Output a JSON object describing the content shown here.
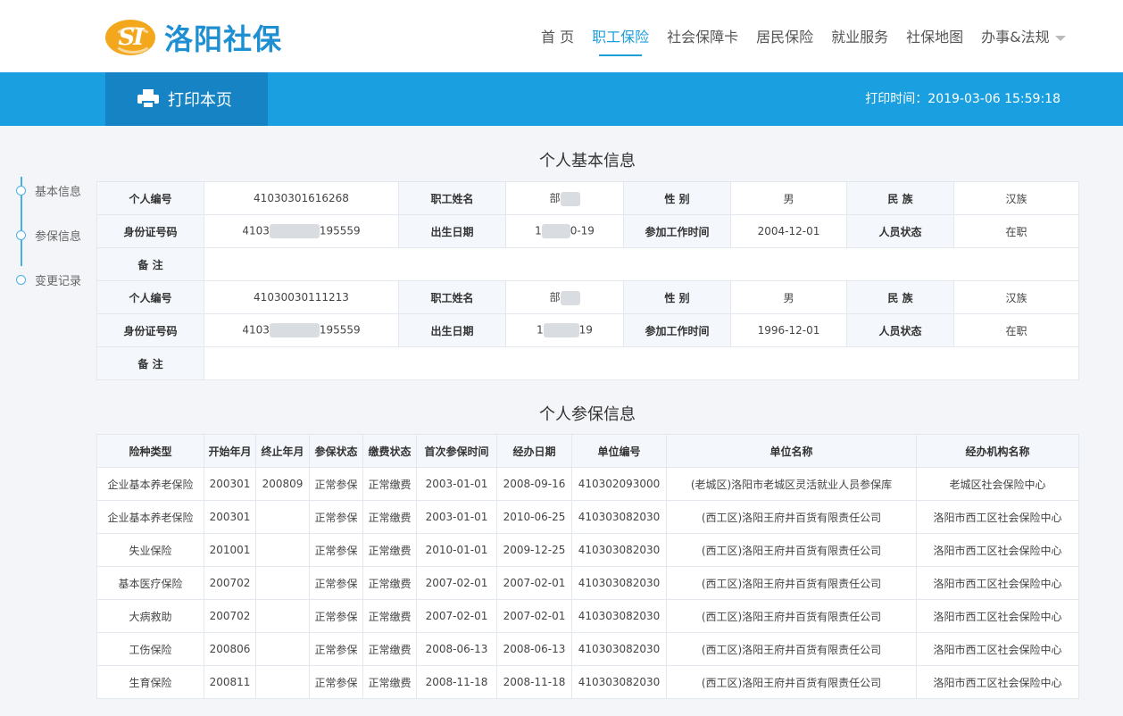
{
  "header": {
    "logo_text": "洛阳社保",
    "logo_badge": "SI",
    "nav": [
      {
        "label": "首 页",
        "active": false
      },
      {
        "label": "职工保险",
        "active": true
      },
      {
        "label": "社会保障卡",
        "active": false
      },
      {
        "label": "居民保险",
        "active": false
      },
      {
        "label": "就业服务",
        "active": false
      },
      {
        "label": "社保地图",
        "active": false
      },
      {
        "label": "办事&法规",
        "active": false,
        "dropdown": true
      }
    ]
  },
  "toolbar": {
    "print_label": "打印本页",
    "print_time": "打印时间：2019-03-06 15:59:18",
    "print_icon": "printer-icon"
  },
  "sidebar": {
    "items": [
      {
        "label": "基本信息"
      },
      {
        "label": "参保信息"
      },
      {
        "label": "变更记录"
      }
    ]
  },
  "basic": {
    "title": "个人基本信息",
    "labels": {
      "person_no": "个人编号",
      "name": "职工姓名",
      "gender": "性 别",
      "ethnicity": "民 族",
      "id_no": "身份证号码",
      "birth": "出生日期",
      "work_start": "参加工作时间",
      "status": "人员状态",
      "remark": "备 注"
    },
    "records": [
      {
        "person_no": "41030301616268",
        "name": "部",
        "gender": "男",
        "ethnicity": "汉族",
        "id_pre": "4103",
        "id_post": "195559",
        "birth_pre": "1",
        "birth_post": "0-19",
        "work_start": "2004-12-01",
        "status": "在职",
        "remark": ""
      },
      {
        "person_no": "41030030111213",
        "name": "部",
        "gender": "男",
        "ethnicity": "汉族",
        "id_pre": "4103",
        "id_post": "195559",
        "birth_pre": "1",
        "birth_post": "19",
        "work_start": "1996-12-01",
        "status": "在职",
        "remark": ""
      }
    ]
  },
  "insurance": {
    "title": "个人参保信息",
    "columns": [
      "险种类型",
      "开始年月",
      "终止年月",
      "参保状态",
      "缴费状态",
      "首次参保时间",
      "经办日期",
      "单位编号",
      "单位名称",
      "经办机构名称"
    ],
    "rows": [
      [
        "企业基本养老保险",
        "200301",
        "200809",
        "正常参保",
        "正常缴费",
        "2003-01-01",
        "2008-09-16",
        "410302093000",
        "(老城区)洛阳市老城区灵活就业人员参保库",
        "老城区社会保险中心"
      ],
      [
        "企业基本养老保险",
        "200301",
        "",
        "正常参保",
        "正常缴费",
        "2003-01-01",
        "2010-06-25",
        "410303082030",
        "(西工区)洛阳王府井百货有限责任公司",
        "洛阳市西工区社会保险中心"
      ],
      [
        "失业保险",
        "201001",
        "",
        "正常参保",
        "正常缴费",
        "2010-01-01",
        "2009-12-25",
        "410303082030",
        "(西工区)洛阳王府井百货有限责任公司",
        "洛阳市西工区社会保险中心"
      ],
      [
        "基本医疗保险",
        "200702",
        "",
        "正常参保",
        "正常缴费",
        "2007-02-01",
        "2007-02-01",
        "410303082030",
        "(西工区)洛阳王府井百货有限责任公司",
        "洛阳市西工区社会保险中心"
      ],
      [
        "大病救助",
        "200702",
        "",
        "正常参保",
        "正常缴费",
        "2007-02-01",
        "2007-02-01",
        "410303082030",
        "(西工区)洛阳王府井百货有限责任公司",
        "洛阳市西工区社会保险中心"
      ],
      [
        "工伤保险",
        "200806",
        "",
        "正常参保",
        "正常缴费",
        "2008-06-13",
        "2008-06-13",
        "410303082030",
        "(西工区)洛阳王府井百货有限责任公司",
        "洛阳市西工区社会保险中心"
      ],
      [
        "生育保险",
        "200811",
        "",
        "正常参保",
        "正常缴费",
        "2008-11-18",
        "2008-11-18",
        "410303082030",
        "(西工区)洛阳王府井百货有限责任公司",
        "洛阳市西工区社会保险中心"
      ]
    ]
  },
  "colors": {
    "brand_blue": "#1aa0e0",
    "print_btn": "#1684c4",
    "logo_orange": "#f3a71c"
  }
}
